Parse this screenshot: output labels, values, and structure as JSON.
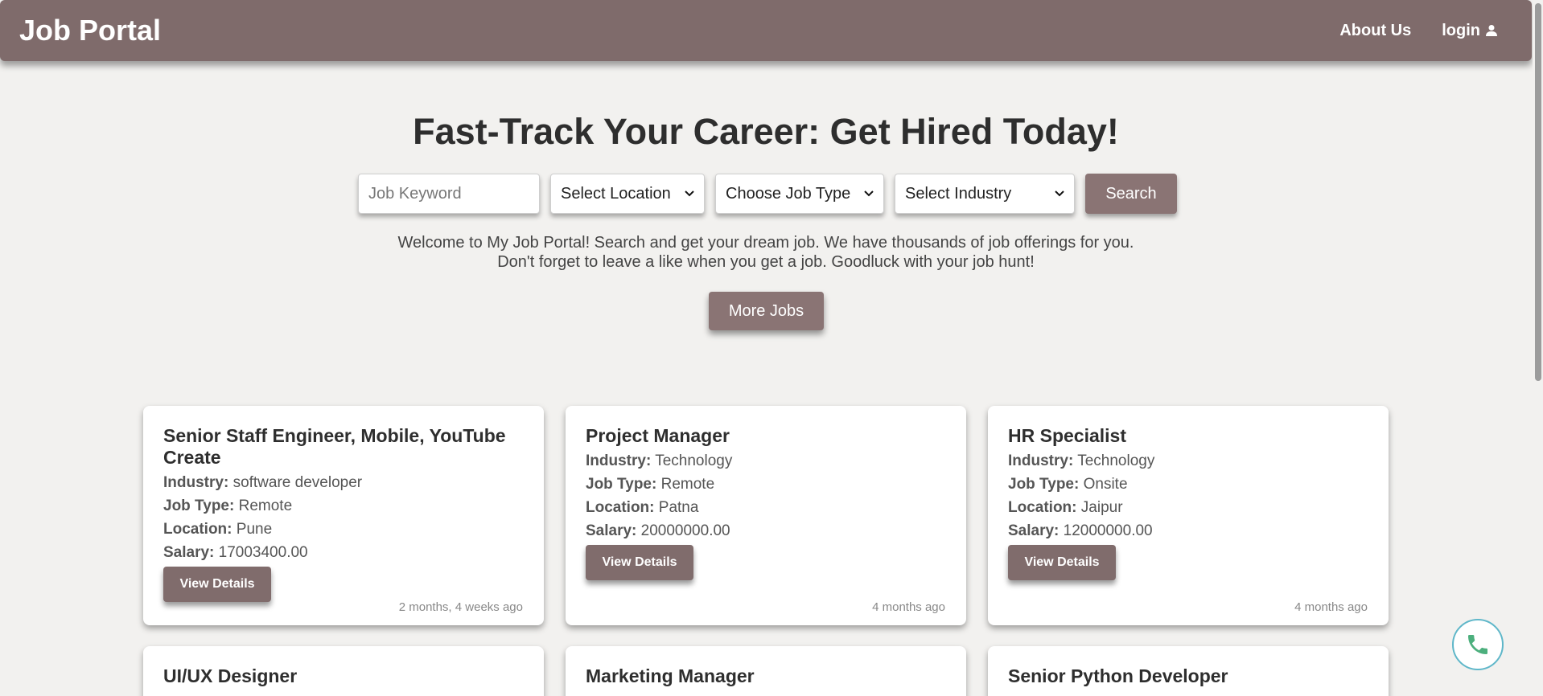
{
  "navbar": {
    "brand": "Job Portal",
    "about_label": "About Us",
    "login_label": "login"
  },
  "hero": {
    "title": "Fast-Track Your Career: Get Hired Today!",
    "welcome_line1": "Welcome to My Job Portal! Search and get your dream job. We have thousands of job offerings for you.",
    "welcome_line2": "Don't forget to leave a like when you get a job. Goodluck with your job hunt!",
    "more_jobs_label": "More Jobs"
  },
  "search": {
    "keyword_placeholder": "Job Keyword",
    "location_selected": "Select Location",
    "job_type_selected": "Choose Job Type",
    "industry_selected": "Select Industry",
    "search_label": "Search"
  },
  "labels": {
    "industry": "Industry:",
    "job_type": "Job Type:",
    "location": "Location:",
    "salary": "Salary:",
    "view_details": "View Details"
  },
  "jobs": [
    {
      "title": "Senior Staff Engineer, Mobile, YouTube Create",
      "industry": "software developer",
      "job_type": "Remote",
      "location": "Pune",
      "salary": "17003400.00",
      "posted": "2 months, 4 weeks ago"
    },
    {
      "title": "Project Manager",
      "industry": "Technology",
      "job_type": "Remote",
      "location": "Patna",
      "salary": "20000000.00",
      "posted": "4 months ago"
    },
    {
      "title": "HR Specialist",
      "industry": "Technology",
      "job_type": "Onsite",
      "location": "Jaipur",
      "salary": "12000000.00",
      "posted": "4 months ago"
    },
    {
      "title": "UI/UX Designer"
    },
    {
      "title": "Marketing Manager"
    },
    {
      "title": "Senior Python Developer"
    }
  ],
  "icons": {
    "user": "user-icon",
    "phone": "phone-icon",
    "chevron": "chevron-down-icon"
  },
  "colors": {
    "navbar": "#7f6b6b",
    "button": "#8a7474",
    "background": "#f2f1ef",
    "phone": "#4caf7d"
  }
}
